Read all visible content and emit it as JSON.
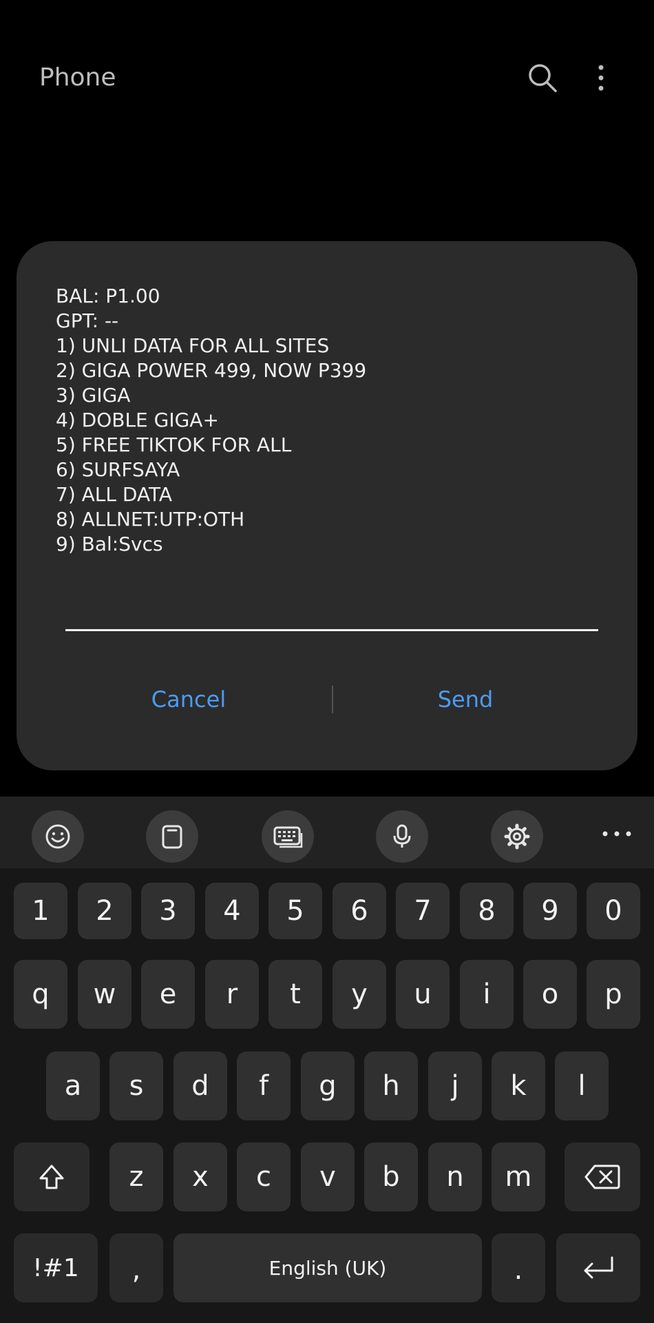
{
  "app": {
    "title": "Phone"
  },
  "dialog": {
    "lines": [
      "BAL: P1.00",
      "GPT: --",
      "1) UNLI DATA FOR ALL SITES",
      "2) GIGA POWER 499, NOW P399",
      "3) GIGA",
      "4) DOBLE GIGA+",
      "5) FREE TIKTOK FOR ALL",
      "6) SURFSAYA",
      "7) ALL DATA",
      "8) ALLNET:UTP:OTH",
      "9) Bal:Svcs"
    ],
    "input_value": "",
    "cancel_label": "Cancel",
    "send_label": "Send"
  },
  "keyboard": {
    "row_numbers": [
      "1",
      "2",
      "3",
      "4",
      "5",
      "6",
      "7",
      "8",
      "9",
      "0"
    ],
    "row_top": [
      "q",
      "w",
      "e",
      "r",
      "t",
      "y",
      "u",
      "i",
      "o",
      "p"
    ],
    "row_middle": [
      "a",
      "s",
      "d",
      "f",
      "g",
      "h",
      "j",
      "k",
      "l"
    ],
    "row_bottom": [
      "z",
      "x",
      "c",
      "v",
      "b",
      "n",
      "m"
    ],
    "symbols_label": "!#1",
    "comma_label": ",",
    "space_label": "English (UK)",
    "period_label": "."
  },
  "colors": {
    "accent": "#4c9bf5",
    "dialog_bg": "#2b2b2b",
    "key_bg": "#303030"
  }
}
